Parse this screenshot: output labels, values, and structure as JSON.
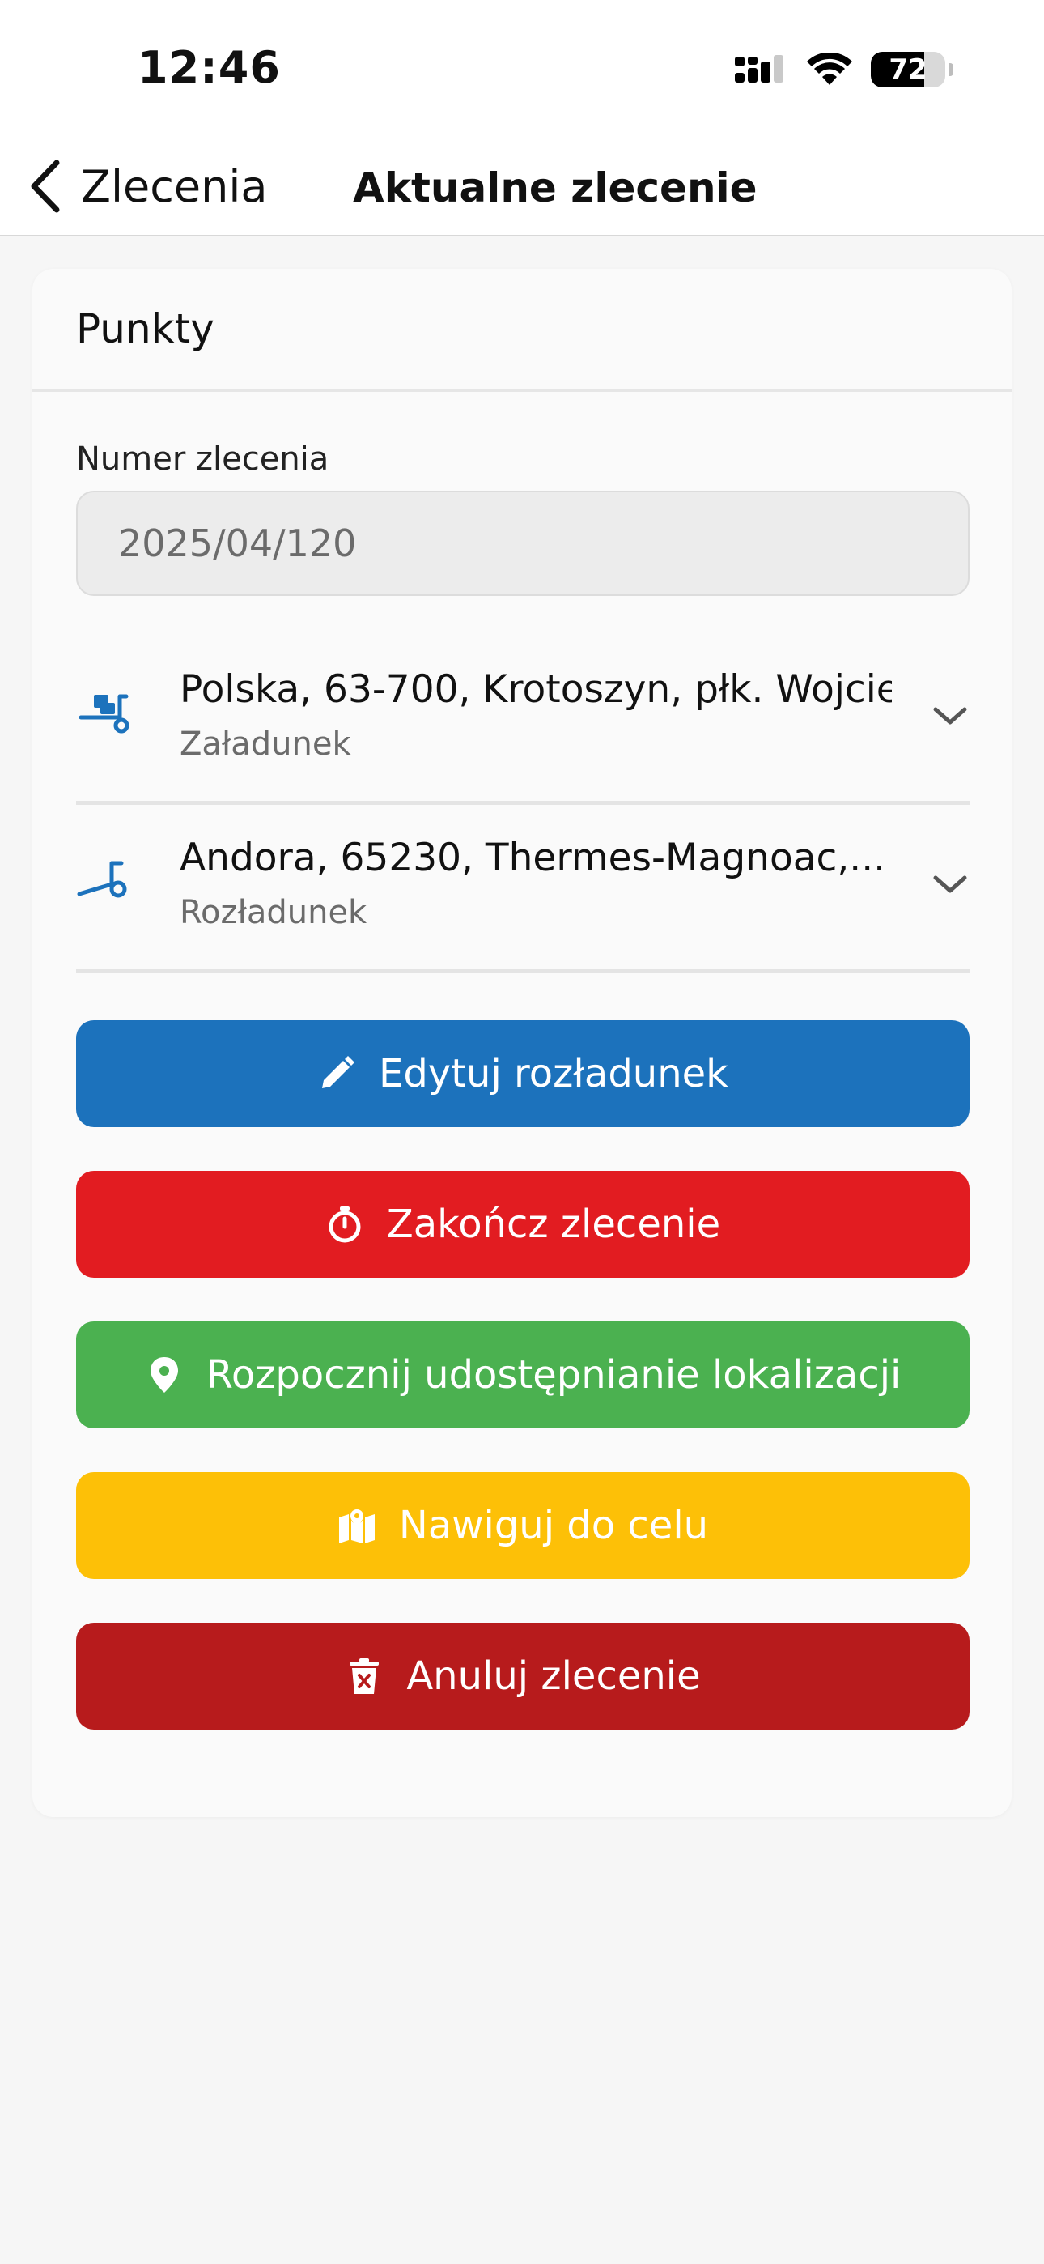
{
  "status_bar": {
    "time": "12:46",
    "battery_level": "72",
    "battery_fraction": 0.72,
    "icons": [
      "cellular-signal-icon",
      "wifi-icon",
      "battery-icon"
    ]
  },
  "nav": {
    "back_label": "Zlecenia",
    "title": "Aktualne zlecenie"
  },
  "card": {
    "title": "Punkty",
    "order_number_label": "Numer zlecenia",
    "order_number_value": "2025/04/120",
    "points": [
      {
        "address": "Polska, 63-700, Krotoszyn, płk. Wojcie...",
        "type": "Załadunek",
        "icon": "loading-dolly-icon"
      },
      {
        "address": "Andora, 65230, Thermes-Magnoac,...",
        "type": "Rozładunek",
        "icon": "empty-dolly-icon"
      }
    ]
  },
  "buttons": {
    "edit_unloading": {
      "label": "Edytuj rozładunek",
      "icon": "pencil-icon",
      "color": "#1c72bc"
    },
    "finish_order": {
      "label": "Zakończ zlecenie",
      "icon": "stopwatch-icon",
      "color": "#e21c21"
    },
    "start_location_sharing": {
      "label": "Rozpocznij udostępnianie lokalizacji",
      "icon": "location-pin-icon",
      "color": "#4bb150"
    },
    "navigate": {
      "label": "Nawiguj do celu",
      "icon": "map-icon",
      "color": "#fdc007"
    },
    "cancel_order": {
      "label": "Anuluj zlecenie",
      "icon": "trash-icon",
      "color": "#b71b1c"
    }
  }
}
